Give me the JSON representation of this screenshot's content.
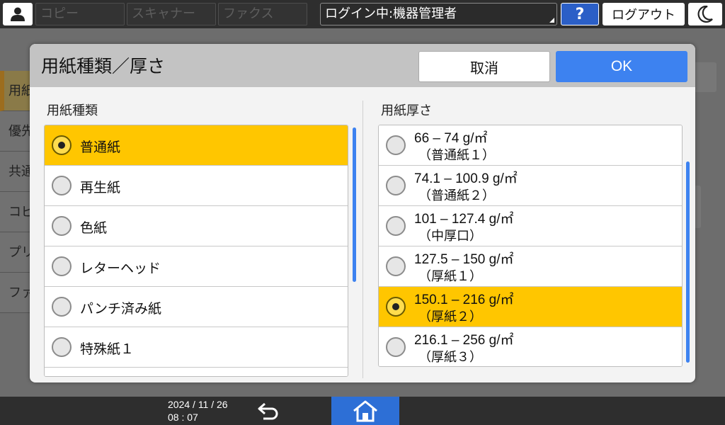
{
  "topbar": {
    "apps": [
      "コピー",
      "スキャナー",
      "ファクス"
    ],
    "login_status": "ログイン中:機器管理者",
    "help_label": "?",
    "logout_label": "ログアウト"
  },
  "background": {
    "sidebar_items": [
      "用紙",
      "優先",
      "共通",
      "コピ",
      "プリ",
      "ファ"
    ]
  },
  "dialog": {
    "title": "用紙種類／厚さ",
    "cancel_label": "取消",
    "ok_label": "OK",
    "paper_type": {
      "heading": "用紙種類",
      "items": [
        "普通紙",
        "再生紙",
        "色紙",
        "レターヘッド",
        "パンチ済み紙",
        "特殊紙１"
      ],
      "selected_index": 0
    },
    "paper_thickness": {
      "heading": "用紙厚さ",
      "items": [
        {
          "range": "66 – 74 g/㎡",
          "name": "（普通紙１）"
        },
        {
          "range": "74.1 – 100.9 g/㎡",
          "name": "（普通紙２）"
        },
        {
          "range": "101 – 127.4 g/㎡",
          "name": "（中厚口）"
        },
        {
          "range": "127.5 – 150 g/㎡",
          "name": "（厚紙１）"
        },
        {
          "range": "150.1 – 216 g/㎡",
          "name": "（厚紙２）"
        },
        {
          "range": "216.1 – 256 g/㎡",
          "name": "（厚紙３）"
        }
      ],
      "selected_index": 4
    }
  },
  "bottombar": {
    "date": "2024 / 11 / 26",
    "time": "08 : 07"
  },
  "colors": {
    "selected": "#ffc600",
    "accent": "#3d82f0"
  },
  "icons": {
    "user": "user-icon",
    "theme": "moon-icon",
    "back": "back-arrow-icon",
    "home": "home-icon"
  }
}
